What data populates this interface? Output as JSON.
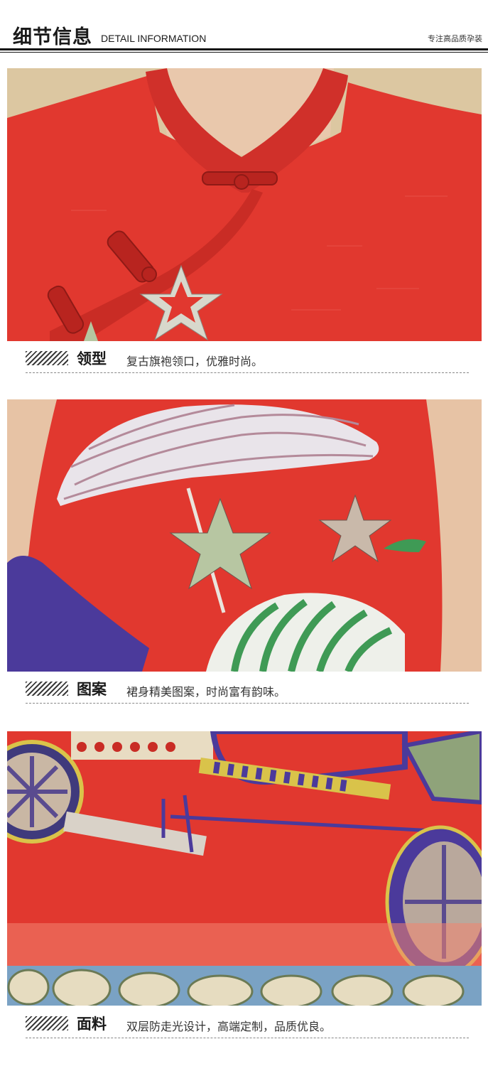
{
  "header": {
    "title_cn": "细节信息",
    "title_en": "DETAIL INFORMATION",
    "tagline": "专注高品质孕装"
  },
  "sections": [
    {
      "title": "领型",
      "description": "复古旗袍领口，优雅时尚。",
      "photo_icon": "collar-detail-photo"
    },
    {
      "title": "图案",
      "description": "裙身精美图案，时尚富有韵味。",
      "photo_icon": "pattern-detail-photo"
    },
    {
      "title": "面料",
      "description": "双层防走光设计，高端定制，品质优良。",
      "photo_icon": "fabric-detail-photo"
    }
  ],
  "colors": {
    "fabric_red": "#e1382f",
    "fabric_red_dark": "#c92c25",
    "print_green": "#3f9a55",
    "print_purple": "#4b3a9b",
    "skin": "#e9c8ac",
    "background_wall": "#dcc7a1"
  }
}
